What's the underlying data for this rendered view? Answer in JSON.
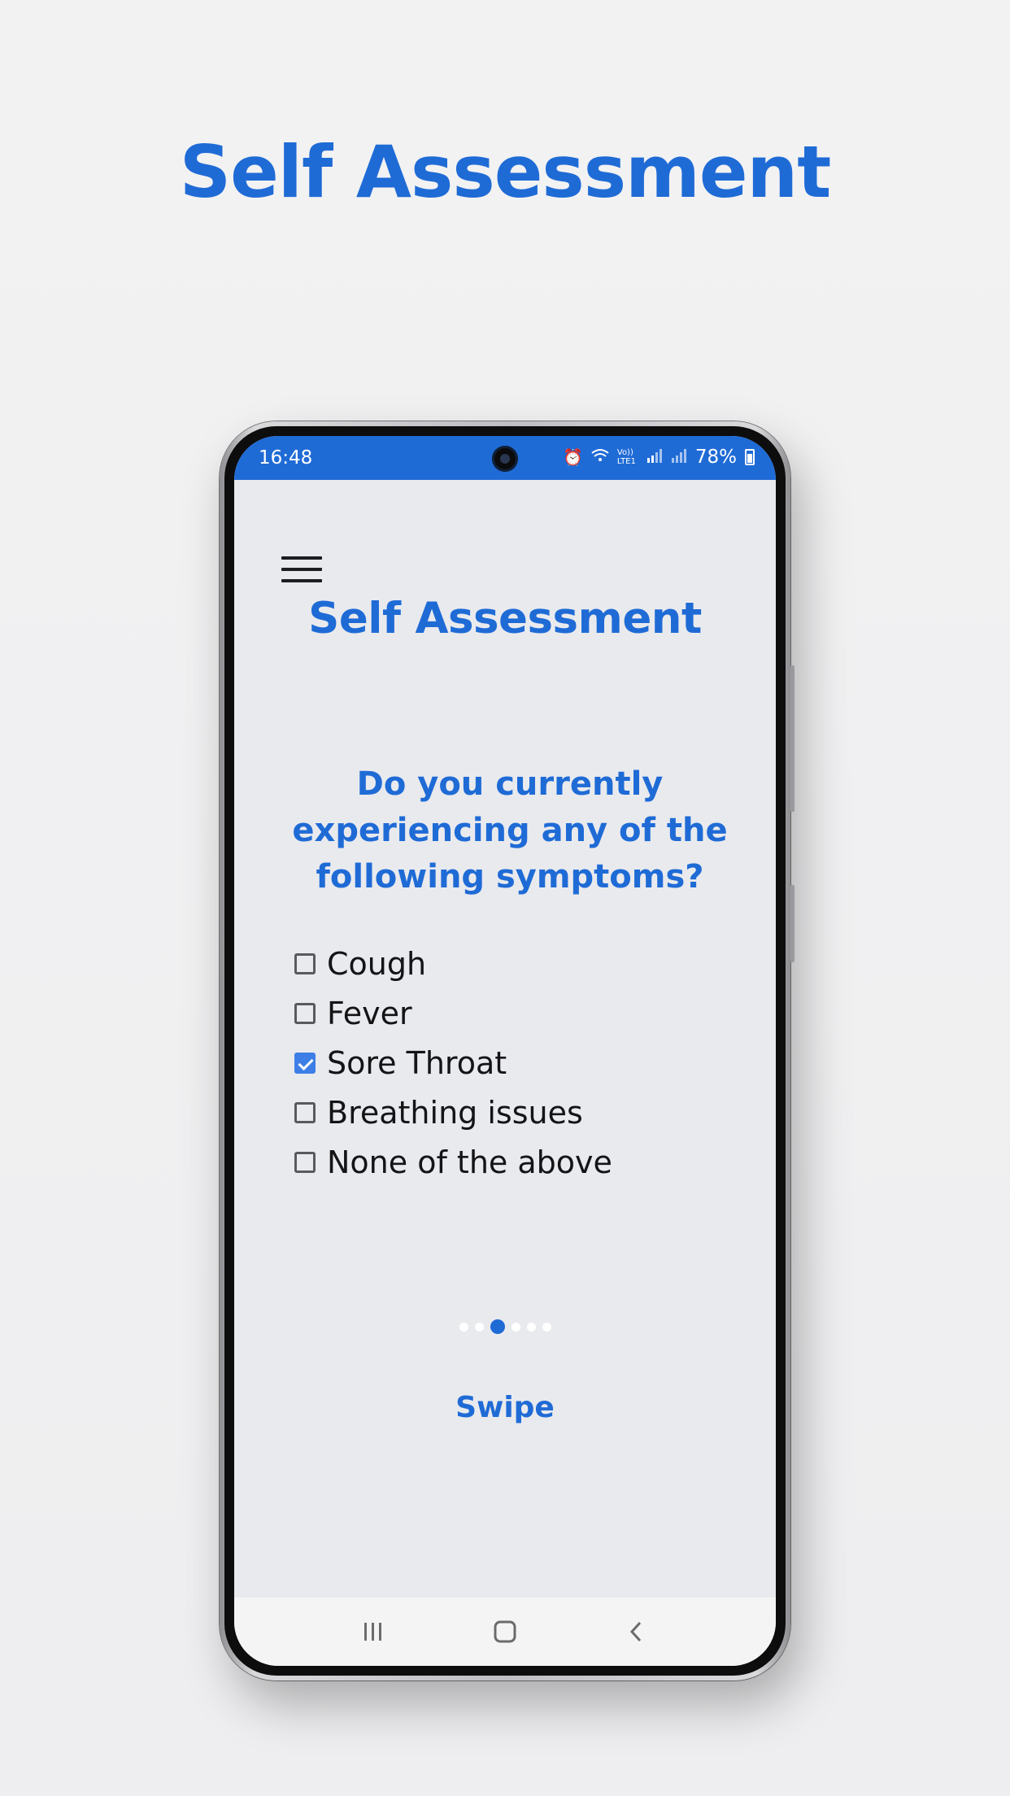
{
  "promo": {
    "title": "Self Assessment"
  },
  "status_bar": {
    "time": "16:48",
    "battery": "78%",
    "icons": [
      "alarm-icon",
      "wifi-icon",
      "volte-icon",
      "signal-icon",
      "signal-icon-2",
      "battery-icon"
    ],
    "volte_label": "Vo)) LTE1"
  },
  "app": {
    "menu_icon": "hamburger-menu-icon",
    "title": "Self Assessment",
    "question": "Do you currently experiencing any of the following symptoms?",
    "options": [
      {
        "label": "Cough",
        "checked": false
      },
      {
        "label": "Fever",
        "checked": false
      },
      {
        "label": "Sore Throat",
        "checked": true
      },
      {
        "label": "Breathing issues",
        "checked": false
      },
      {
        "label": "None of the above",
        "checked": false
      }
    ],
    "pager": {
      "count": 6,
      "active_index": 2
    },
    "swipe_label": "Swipe"
  },
  "nav_bar": {
    "buttons": [
      "recents-icon",
      "home-icon",
      "back-icon"
    ]
  },
  "colors": {
    "accent": "#1f6bd6",
    "checkbox_checked": "#3d7fe6",
    "screen_bg": "#e9eaee"
  }
}
